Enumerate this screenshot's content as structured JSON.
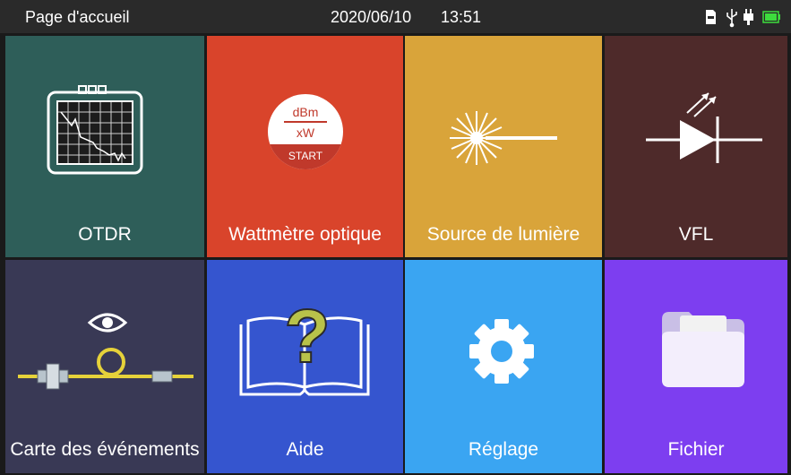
{
  "status_bar": {
    "title": "Page d'accueil",
    "date": "2020/06/10",
    "time": "13:51",
    "icons": [
      "sd-card-icon",
      "usb-icon",
      "power-plug-icon",
      "battery-icon"
    ],
    "battery_color": "#3ddc3d"
  },
  "tiles": [
    {
      "label": "OTDR",
      "icon": "otdr-device-icon",
      "color": "#2e5e59"
    },
    {
      "label": "Wattmètre optique",
      "icon": "power-meter-icon",
      "color": "#d9442b",
      "icon_text_top": "dBm",
      "icon_text_bottom": "xW",
      "icon_badge": "START"
    },
    {
      "label": "Source de lumière",
      "icon": "light-source-icon",
      "color": "#d9a43a"
    },
    {
      "label": "VFL",
      "icon": "laser-diode-icon",
      "color": "#4e2a2a"
    },
    {
      "label": "Carte des événements",
      "icon": "event-map-icon",
      "color": "#393955"
    },
    {
      "label": "Aide",
      "icon": "help-book-icon",
      "color": "#3555cf"
    },
    {
      "label": "Réglage",
      "icon": "gear-icon",
      "color": "#3aa5f2"
    },
    {
      "label": "Fichier",
      "icon": "folder-icon",
      "color": "#7d3ef0"
    }
  ]
}
